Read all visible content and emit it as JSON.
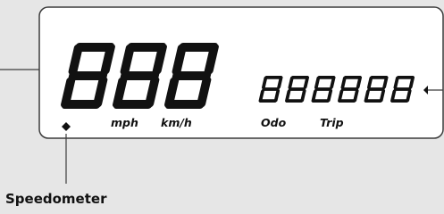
{
  "display": {
    "speed_digits": "888",
    "odo_digits": "888888",
    "units": {
      "mph": "mph",
      "kmh": "km/h",
      "odo": "Odo",
      "trip": "Trip"
    }
  },
  "labels": {
    "speedometer": "Speedometer"
  }
}
